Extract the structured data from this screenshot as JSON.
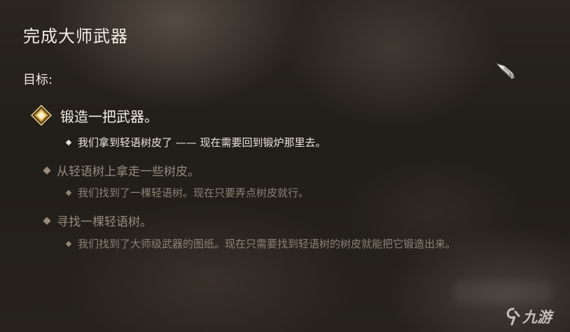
{
  "quest": {
    "title": "完成大师武器",
    "objectives_label": "目标:",
    "current_objective": {
      "text": "锻造一把武器。",
      "note": "我们拿到轻语树皮了 —— 现在需要回到锻炉那里去。"
    },
    "completed_objectives": [
      {
        "text": "从轻语树上拿走一些树皮。",
        "note": "我们找到了一棵轻语树。现在只要弄点树皮就行。"
      },
      {
        "text": "寻找一棵轻语树。",
        "note": "我们找到了大师级武器的图纸。现在只需要找到轻语树的树皮就能把它锻造出来。"
      }
    ]
  },
  "icons": {
    "active_objective": "golden-diamond-gem-icon",
    "completed_objective": "diamond-bullet-icon",
    "cursor": "gauntlet-cursor-icon"
  },
  "watermark": {
    "text": "九游"
  },
  "colors": {
    "active_text": "#f3eee6",
    "completed_text": "#968b7d",
    "gem_gold": "#e8c46a"
  }
}
